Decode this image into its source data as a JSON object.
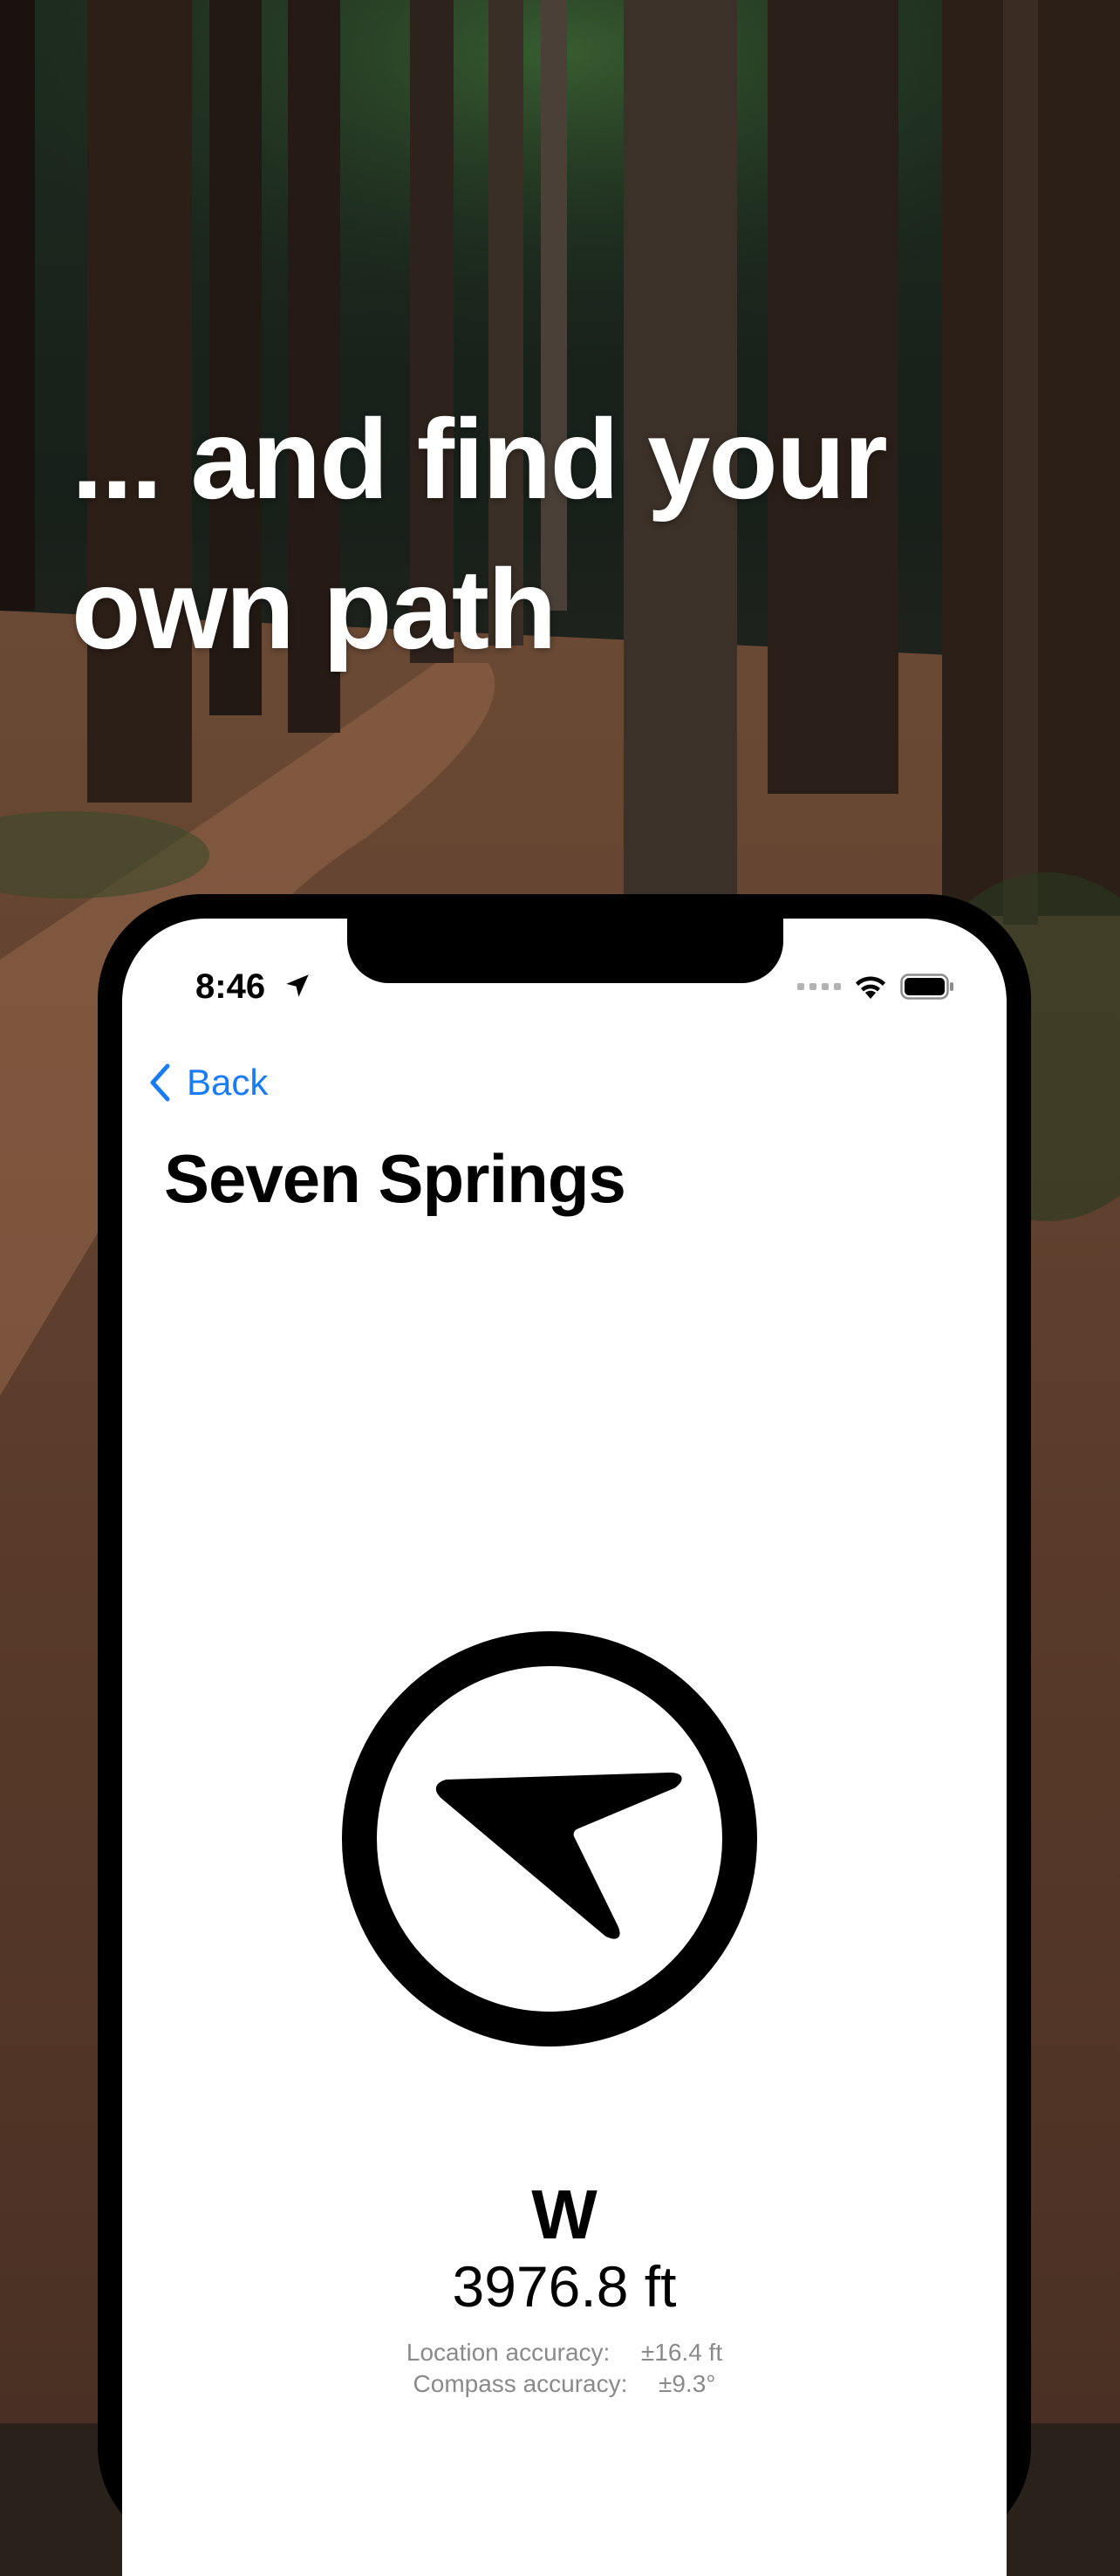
{
  "headline": {
    "line1": "... and find your",
    "line2": "own path"
  },
  "status_bar": {
    "time": "8:46",
    "icons": [
      "location-arrow-icon",
      "cellular-signal-icon",
      "wifi-icon",
      "battery-icon"
    ]
  },
  "nav": {
    "back_label": "Back"
  },
  "page": {
    "title": "Seven Springs"
  },
  "compass": {
    "icon": "navigation-arrow-icon",
    "direction": "W",
    "distance": "3976.8 ft",
    "location_accuracy_label": "Location accuracy:",
    "location_accuracy_value": "±16.4 ft",
    "compass_accuracy_label": "Compass accuracy:",
    "compass_accuracy_value": "±9.3°"
  },
  "colors": {
    "accent": "#1a7cf5",
    "text": "#000000",
    "secondary_text": "#8a8a8a",
    "screen_bg": "#ffffff"
  }
}
